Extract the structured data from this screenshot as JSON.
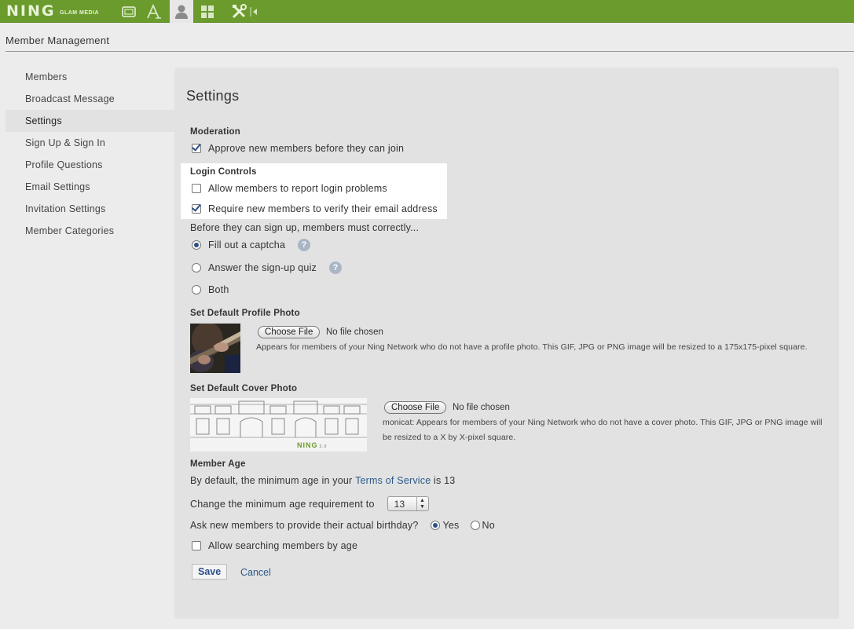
{
  "topbar": {
    "logo": "NING",
    "logo_sub": "GLAM MEDIA",
    "icons": [
      "tv-icon",
      "font-icon",
      "person-icon",
      "grid-icon",
      "tools-icon",
      "collapse-icon"
    ]
  },
  "header": {
    "title": "Member Management"
  },
  "sidebar": {
    "items": [
      {
        "label": "Members"
      },
      {
        "label": "Broadcast Message"
      },
      {
        "label": "Settings"
      },
      {
        "label": "Sign Up & Sign In"
      },
      {
        "label": "Profile Questions"
      },
      {
        "label": "Email Settings"
      },
      {
        "label": "Invitation Settings"
      },
      {
        "label": "Member Categories"
      }
    ]
  },
  "panel": {
    "title": "Settings",
    "moderation": {
      "label": "Moderation",
      "approve_label": "Approve new members before they can join",
      "approve_checked": true
    },
    "login_controls": {
      "label": "Login Controls",
      "report_label": "Allow members to report login problems",
      "report_checked": false,
      "verify_label": "Require new members to verify their email address",
      "verify_checked": true
    },
    "signup": {
      "intro": "Before they can sign up, members must correctly...",
      "options": [
        {
          "label": "Fill out a captcha",
          "checked": true,
          "help": "?"
        },
        {
          "label": "Answer the sign-up quiz",
          "checked": false,
          "help": "?"
        },
        {
          "label": "Both",
          "checked": false
        }
      ]
    },
    "profile_photo": {
      "label": "Set Default Profile Photo",
      "button": "Choose File",
      "status": "No file chosen",
      "note": "Appears for members of your Ning Network who do not have a profile photo. This GIF, JPG or PNG image will be resized to a 175x175-pixel square."
    },
    "cover_photo": {
      "label": "Set Default Cover Photo",
      "button": "Choose File",
      "status": "No file chosen",
      "note_line1": "monicat: Appears for members of your Ning Network who do not have a cover photo. This GIF, JPG or PNG image will",
      "note_line2": "be resized to a X by X-pixel square.",
      "watermark": "NING",
      "watermark_sub": "3.0"
    },
    "member_age": {
      "label": "Member Age",
      "default_prefix": "By default, the minimum age in your ",
      "tos_link": "Terms of Service",
      "default_suffix": " is 13",
      "change_label": "Change the minimum age requirement to",
      "min_age": "13",
      "birthday_question": "Ask new members to provide their actual birthday?",
      "yes_label": "Yes",
      "no_label": "No",
      "birthday_yes": true,
      "search_label": "Allow searching members by age",
      "search_checked": false
    },
    "actions": {
      "save": "Save",
      "cancel": "Cancel"
    }
  }
}
